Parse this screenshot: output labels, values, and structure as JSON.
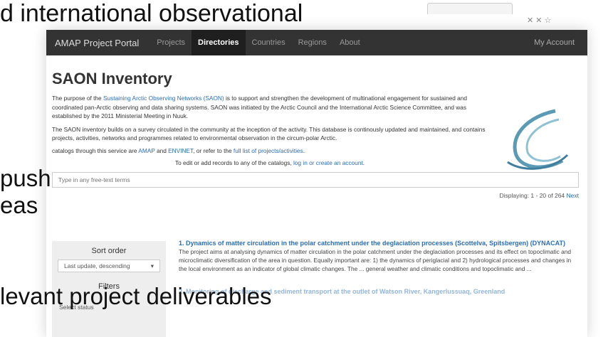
{
  "slide": {
    "top_text": "d international observational",
    "push_text": "push",
    "eas_text": "eas",
    "bottom_text": "levant project deliverables"
  },
  "navbar": {
    "brand": "AMAP Project Portal",
    "items": [
      {
        "label": "Projects",
        "active": false
      },
      {
        "label": "Directories",
        "active": true
      },
      {
        "label": "Countries",
        "active": false
      },
      {
        "label": "Regions",
        "active": false
      },
      {
        "label": "About",
        "active": false
      }
    ],
    "account": "My Account"
  },
  "page": {
    "title": "SAON Inventory",
    "intro_prefix": "The purpose of the ",
    "intro_link": "Sustaining Arctic Observing Networks (SAON)",
    "intro_suffix": " is to support and strengthen the development of multinational engagement for sustained and coordinated pan-Arctic observing and data sharing systems. SAON was initiated by the Arctic Council and the International Arctic Science Committee, and was established by the 2011 Ministerial Meeting in Nuuk.",
    "para2": "The SAON inventory builds on a survey circulated in the community at the inception of the activity. This database is continously updated and maintained, and contains projects, activities, networks and programmes related to environmental observation in the circum-polar Arctic.",
    "catalog_prefix": "catalogs through this service are ",
    "catalog_link1": "AMAP",
    "catalog_and": " and ",
    "catalog_link2": "ENVINET",
    "catalog_mid": ", or refer to the ",
    "catalog_link3": "full list of projects/activities",
    "catalog_end": ".",
    "edit_prefix": "To edit or add records to any of the catalogs, ",
    "edit_link": "log in or create an account",
    "edit_end": "."
  },
  "search": {
    "placeholder": "Type in any free-text terms"
  },
  "display": {
    "text": "Displaying: 1 - 20 of 264 ",
    "next": "Next"
  },
  "sidebar": {
    "sort_title": "Sort order",
    "sort_value": "Last update, descending",
    "filters_title": "Filters",
    "status_placeholder": "Select status"
  },
  "results": [
    {
      "title": "1. Dynamics of matter circulation in the polar catchment under the deglaciation processes (Scottelva, Spitsbergen) (DYNACAT)",
      "body": "The project aims at analysing dynamics of matter circulation in the polar catchment under the deglaciation processes and its effect on topoclimatic and microclimatic diversification of the area in question. Equally important are: 1) the dynamics of periglacial and 2) hydrological processes and changes in the local environment as an indicator of global climatic changes. The ... general weather and climatic conditions and topoclimatic and ..."
    },
    {
      "title": "2. Monitoring of discharge and sediment transport at the outlet of Watson River, Kangerlussuaq, Greenland",
      "body": ""
    }
  ]
}
